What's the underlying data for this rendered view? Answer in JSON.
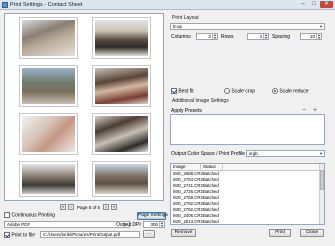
{
  "window": {
    "title": "Print Settings - Contact Sheet",
    "minimize": "–",
    "maximize": "□",
    "close": "✕"
  },
  "preview": {
    "pager": {
      "first": "«",
      "prev": "‹",
      "label": "Page 5 of 5",
      "next": "›",
      "last": "»"
    }
  },
  "print_layout": {
    "group_label": "Print Layout",
    "layout_select": "8-up",
    "columns_label": "Columns",
    "columns_value": "2",
    "rows_label": "Rows",
    "rows_value": "4",
    "spacing_label": "Spacing",
    "spacing_value": "10",
    "fit_options": [
      "Best fit",
      "Scale crop",
      "Scale reduce"
    ],
    "fit_selected": "Scale reduce"
  },
  "additional": {
    "group_label": "Additional Image Settings",
    "apply_presets_label": "Apply Presets",
    "remove_preset_icon": "minus-icon",
    "add_preset_icon": "plus-icon",
    "color_space_label": "Output Color Space / Print Profile",
    "color_space_value": "srgb"
  },
  "image_list": {
    "columns": [
      "Image",
      "Status"
    ],
    "rows": [
      {
        "name": "IMG_2688.CR2",
        "status": "Batched"
      },
      {
        "name": "IMG_2764.CR2",
        "status": "Batched"
      },
      {
        "name": "IMG_2741.CR2",
        "status": "Batched"
      },
      {
        "name": "IMG_2726.CR2",
        "status": "Batched"
      },
      {
        "name": "IMG_2768.CR2",
        "status": "Batched"
      },
      {
        "name": "IMG_2792.CR2",
        "status": "Batched"
      },
      {
        "name": "IMG_2792.CR2",
        "status": "Batched"
      },
      {
        "name": "IMG_2406.CR2",
        "status": "Batched"
      },
      {
        "name": "IMG_2513.CR2",
        "status": "Batched"
      }
    ]
  },
  "bottom": {
    "continuous_label": "Continuous Printing",
    "printer_value": "Adobe PDF",
    "page_settings_label": "Page Settings",
    "print_to_file_label": "Print to file",
    "file_path": "C:/Users/loriki/Pictures/PrintOutput.pdf",
    "browse_label": "...",
    "output_dpi_label": "Output DPI",
    "output_dpi_value": "300",
    "remove_label": "Remove",
    "print_label": "Print",
    "close_label": "Close"
  }
}
